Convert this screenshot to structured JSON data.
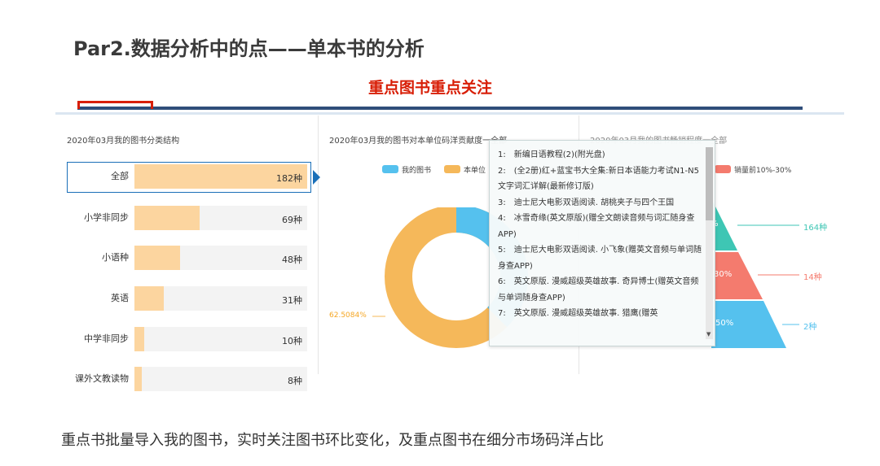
{
  "slide": {
    "title": "Par2.数据分析中的点——单本书的分析",
    "highlight_heading": "重点图书重点关注",
    "caption": "重点书批量导入我的图书，实时关注图书环比变化，及重点图书在细分市场码洋占比"
  },
  "panel1": {
    "title": "2020年03月我的图书分类结构",
    "rows": [
      {
        "label": "全部",
        "value": "182种",
        "count": 182,
        "selected": true
      },
      {
        "label": "小学非同步",
        "value": "69种",
        "count": 69
      },
      {
        "label": "小语种",
        "value": "48种",
        "count": 48
      },
      {
        "label": "英语",
        "value": "31种",
        "count": 31
      },
      {
        "label": "中学非同步",
        "value": "10种",
        "count": 10
      },
      {
        "label": "课外文教读物",
        "value": "8种",
        "count": 8
      }
    ]
  },
  "panel2": {
    "title": "2020年03月我的图书对本单位码洋贡献度一全部",
    "legend": [
      {
        "label": "我的图书",
        "color": "#55c1ee"
      },
      {
        "label": "本单位",
        "color": "#f5b85a"
      }
    ],
    "donut_label": "62.5084%",
    "donut_share": 0.625
  },
  "panel3": {
    "title": "2020年03月我的图书畅销程度一全部",
    "legend": [
      {
        "label": "销量前10%-30%",
        "color": "#f47b6e"
      }
    ],
    "funnel": [
      {
        "label": "%",
        "value": "164种",
        "color": "#3ec6b4"
      },
      {
        "label": "30%",
        "value": "14种",
        "color": "#f47b6e"
      },
      {
        "label": "50%",
        "value": "2种",
        "color": "#55c1ee"
      }
    ]
  },
  "tooltip": {
    "items": [
      "1:　新编日语教程(2)(附光盘)",
      "2:　(全2册)红+蓝宝书大全集:新日本语能力考试N1-N5文字词汇详解(最新修订版)",
      "3:　迪士尼大电影双语阅读. 胡桃夹子与四个王国",
      "4:　冰雪奇缘(英文原版)(赠全文朗读音频与词汇随身查APP)",
      "5:　迪士尼大电影双语阅读. 小飞象(赠英文音频与单词随身查APP)",
      "6:　英文原版. 漫威超级英雄故事. 奇异博士(赠英文音频与单词随身查APP)",
      "7:　英文原版. 漫威超级英雄故事. 猎鹰(赠英"
    ]
  },
  "colors": {
    "accent_red": "#d81e06",
    "header_blue": "#2f4e7a",
    "bar_fill": "#fcd59f",
    "select_blue": "#1a6fb8"
  }
}
